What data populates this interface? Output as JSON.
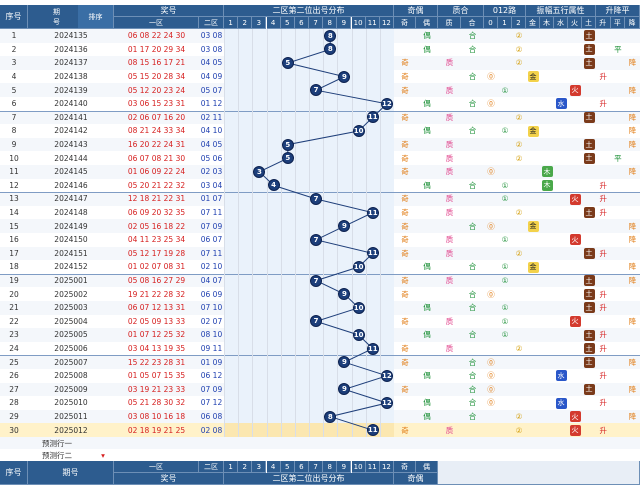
{
  "headers": {
    "seq": "序号",
    "period": "期号",
    "period_top": "期",
    "period_bottom": "号",
    "sort_label": "排序",
    "prize": "奖号",
    "zone1": "一区",
    "zone2": "二区",
    "distribution": "二区第二位出号分布",
    "odd_even": "奇偶",
    "prime_comp": "质合",
    "road012": "012路",
    "five_elements": "振幅五行属性",
    "updown": "升降平",
    "sub_odd": "奇",
    "sub_even": "偶",
    "sub_prime": "质",
    "sub_comp": "合",
    "r0": "0",
    "r1": "1",
    "r2": "2",
    "el_jin": "金",
    "el_mu": "木",
    "el_shui": "水",
    "el_huo": "火",
    "el_tu": "土",
    "ud_up": "升",
    "ud_flat": "平",
    "ud_down": "降",
    "dist_nums": [
      "1",
      "2",
      "3",
      "4",
      "5",
      "6",
      "7",
      "8",
      "9",
      "10",
      "11",
      "12"
    ]
  },
  "rows": [
    {
      "seq": "1",
      "period": "2024135",
      "zone1": "06 08 22 24 30",
      "zone2": "03 08",
      "pos": 8,
      "oe": "偶",
      "pc": "合",
      "r": 2,
      "el": "土",
      "ud": ""
    },
    {
      "seq": "2",
      "period": "2024136",
      "zone1": "01 17 20 29 34",
      "zone2": "03 08",
      "pos": 8,
      "oe": "偶",
      "pc": "合",
      "r": 2,
      "el": "土",
      "ud": "平"
    },
    {
      "seq": "3",
      "period": "2024137",
      "zone1": "08 15 16 17 21",
      "zone2": "04 05",
      "pos": 5,
      "oe": "奇",
      "pc": "质",
      "r": 2,
      "el": "土",
      "ud": "降"
    },
    {
      "seq": "4",
      "period": "2024138",
      "zone1": "05 15 20 28 34",
      "zone2": "04 09",
      "pos": 9,
      "oe": "奇",
      "pc": "合",
      "r": 0,
      "el": "金",
      "ud": "升"
    },
    {
      "seq": "5",
      "period": "2024139",
      "zone1": "05 12 20 23 24",
      "zone2": "05 07",
      "pos": 7,
      "oe": "奇",
      "pc": "质",
      "r": 1,
      "el": "火",
      "ud": "降"
    },
    {
      "seq": "6",
      "period": "2024140",
      "zone1": "03 06 15 23 31",
      "zone2": "01 12",
      "pos": 12,
      "oe": "偶",
      "pc": "合",
      "r": 0,
      "el": "水",
      "ud": "升"
    },
    {
      "seq": "7",
      "period": "2024141",
      "zone1": "02 06 07 16 20",
      "zone2": "02 11",
      "pos": 11,
      "oe": "奇",
      "pc": "质",
      "r": 2,
      "el": "土",
      "ud": "降"
    },
    {
      "seq": "8",
      "period": "2024142",
      "zone1": "08 21 24 33 34",
      "zone2": "04 10",
      "pos": 10,
      "oe": "偶",
      "pc": "合",
      "r": 1,
      "el": "金",
      "ud": "降"
    },
    {
      "seq": "9",
      "period": "2024143",
      "zone1": "16 20 22 24 31",
      "zone2": "04 05",
      "pos": 5,
      "oe": "奇",
      "pc": "质",
      "r": 2,
      "el": "土",
      "ud": "降"
    },
    {
      "seq": "10",
      "period": "2024144",
      "zone1": "06 07 08 21 30",
      "zone2": "05 06",
      "pos": 5,
      "oe": "奇",
      "pc": "质",
      "r": 2,
      "el": "土",
      "ud": "平"
    },
    {
      "seq": "11",
      "period": "2024145",
      "zone1": "01 06 09 22 24",
      "zone2": "02 03",
      "pos": 3,
      "oe": "奇",
      "pc": "质",
      "r": 0,
      "el": "木",
      "ud": "降"
    },
    {
      "seq": "12",
      "period": "2024146",
      "zone1": "05 20 21 22 32",
      "zone2": "03 04",
      "pos": 4,
      "oe": "偶",
      "pc": "合",
      "r": 1,
      "el": "木",
      "ud": "升"
    },
    {
      "seq": "13",
      "period": "2024147",
      "zone1": "12 18 21 22 31",
      "zone2": "01 07",
      "pos": 7,
      "oe": "奇",
      "pc": "质",
      "r": 1,
      "el": "火",
      "ud": "升"
    },
    {
      "seq": "14",
      "period": "2024148",
      "zone1": "06 09 20 32 35",
      "zone2": "07 11",
      "pos": 11,
      "oe": "奇",
      "pc": "质",
      "r": 2,
      "el": "土",
      "ud": "升"
    },
    {
      "seq": "15",
      "period": "2024149",
      "zone1": "02 05 16 18 22",
      "zone2": "07 09",
      "pos": 9,
      "oe": "奇",
      "pc": "合",
      "r": 0,
      "el": "金",
      "ud": "降"
    },
    {
      "seq": "16",
      "period": "2024150",
      "zone1": "04 11 23 25 34",
      "zone2": "06 07",
      "pos": 7,
      "oe": "奇",
      "pc": "质",
      "r": 1,
      "el": "火",
      "ud": "降"
    },
    {
      "seq": "17",
      "period": "2024151",
      "zone1": "05 12 17 19 28",
      "zone2": "07 11",
      "pos": 11,
      "oe": "奇",
      "pc": "质",
      "r": 2,
      "el": "土",
      "ud": "升"
    },
    {
      "seq": "18",
      "period": "2024152",
      "zone1": "01 02 07 08 31",
      "zone2": "02 10",
      "pos": 10,
      "oe": "偶",
      "pc": "合",
      "r": 1,
      "el": "金",
      "ud": "降"
    },
    {
      "seq": "19",
      "period": "2025001",
      "zone1": "05 08 16 27 29",
      "zone2": "04 07",
      "pos": 7,
      "oe": "奇",
      "pc": "质",
      "r": 1,
      "el": "土",
      "ud": "降"
    },
    {
      "seq": "20",
      "period": "2025002",
      "zone1": "19 21 22 28 32",
      "zone2": "06 09",
      "pos": 9,
      "oe": "奇",
      "pc": "合",
      "r": 0,
      "el": "土",
      "ud": "升"
    },
    {
      "seq": "21",
      "period": "2025003",
      "zone1": "06 07 12 13 31",
      "zone2": "07 10",
      "pos": 10,
      "oe": "偶",
      "pc": "合",
      "r": 1,
      "el": "土",
      "ud": "升"
    },
    {
      "seq": "22",
      "period": "2025004",
      "zone1": "02 05 09 13 33",
      "zone2": "02 07",
      "pos": 7,
      "oe": "奇",
      "pc": "质",
      "r": 1,
      "el": "火",
      "ud": "降"
    },
    {
      "seq": "23",
      "period": "2025005",
      "zone1": "01 07 12 25 32",
      "zone2": "08 10",
      "pos": 10,
      "oe": "偶",
      "pc": "合",
      "r": 1,
      "el": "土",
      "ud": "升"
    },
    {
      "seq": "24",
      "period": "2025006",
      "zone1": "03 04 13 19 35",
      "zone2": "09 11",
      "pos": 11,
      "oe": "奇",
      "pc": "质",
      "r": 2,
      "el": "土",
      "ud": "升"
    },
    {
      "seq": "25",
      "period": "2025007",
      "zone1": "15 22 23 28 31",
      "zone2": "01 09",
      "pos": 9,
      "oe": "奇",
      "pc": "合",
      "r": 0,
      "el": "土",
      "ud": "降"
    },
    {
      "seq": "26",
      "period": "2025008",
      "zone1": "01 05 07 15 35",
      "zone2": "06 12",
      "pos": 12,
      "oe": "偶",
      "pc": "合",
      "r": 0,
      "el": "水",
      "ud": "升"
    },
    {
      "seq": "27",
      "period": "2025009",
      "zone1": "03 19 21 23 33",
      "zone2": "07 09",
      "pos": 9,
      "oe": "奇",
      "pc": "合",
      "r": 0,
      "el": "土",
      "ud": "降"
    },
    {
      "seq": "28",
      "period": "2025010",
      "zone1": "05 21 28 30 32",
      "zone2": "07 12",
      "pos": 12,
      "oe": "偶",
      "pc": "合",
      "r": 0,
      "el": "水",
      "ud": "升"
    },
    {
      "seq": "29",
      "period": "2025011",
      "zone1": "03 08 10 16 18",
      "zone2": "06 08",
      "pos": 8,
      "oe": "偶",
      "pc": "合",
      "r": 2,
      "el": "火",
      "ud": "降"
    },
    {
      "seq": "30",
      "period": "2025012",
      "zone1": "02 18 19 21 25",
      "zone2": "02 08",
      "pos": 11,
      "oe": "奇",
      "pc": "质",
      "r": 2,
      "el": "火",
      "ud": "升"
    }
  ],
  "forecast": {
    "row1": "预测行一",
    "row2": "预测行二"
  },
  "colors": {
    "header_bg": "#2d5c8f",
    "ball": "#1c3e7a",
    "line": "#1f3f7a",
    "highlight_row": "#fff2c9",
    "alt_row": "#f4f7fb",
    "dist_bg": "#eaf2fb"
  }
}
